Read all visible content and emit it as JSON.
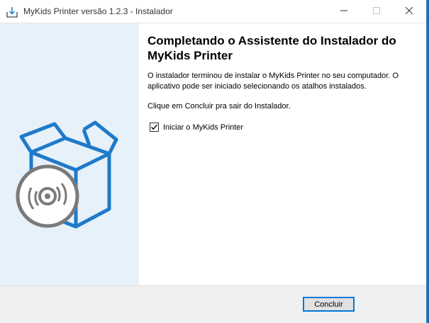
{
  "window": {
    "title": "MyKids Printer versão 1.2.3 - Instalador"
  },
  "main": {
    "heading": "Completando o Assistente do Instalador do MyKids Printer",
    "paragraph1": "O instalador terminou de instalar o MyKids Printer no seu computador. O aplicativo pode ser iniciado selecionando os atalhos instalados.",
    "paragraph2": "Clique em Concluir pra sair do Instalador.",
    "checkbox": {
      "label": "Iniciar o MyKids Printer",
      "checked": true
    }
  },
  "footer": {
    "finish_label": "Concluir"
  },
  "icons": {
    "app": "installer-icon",
    "minimize": "minimize-icon",
    "maximize": "maximize-icon",
    "close": "close-icon",
    "artwork": "box-with-disc-icon"
  },
  "colors": {
    "accent": "#0078d7",
    "box_blue": "#1f7ac8",
    "side_panel": "#e6f1fa",
    "disc_gray": "#7a7a7a"
  }
}
